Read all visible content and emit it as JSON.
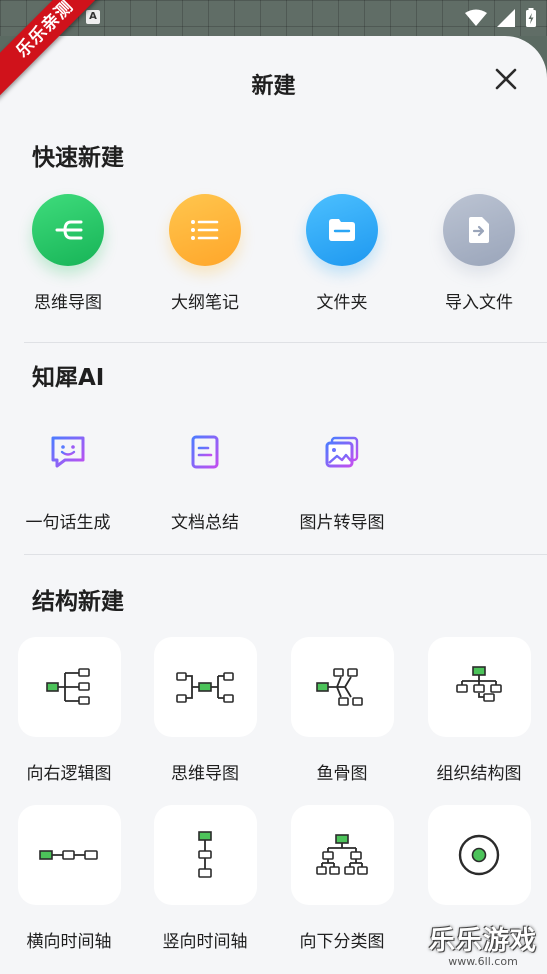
{
  "badge": "乐乐亲测",
  "header": {
    "title": "新建"
  },
  "quick": {
    "title": "快速新建",
    "items": [
      {
        "label": "思维导图",
        "icon": "mindmap-icon",
        "color": "#22c35e"
      },
      {
        "label": "大纲笔记",
        "icon": "outline-list-icon",
        "color": "#ffb627"
      },
      {
        "label": "文件夹",
        "icon": "folder-icon",
        "color": "#2aa6f5"
      },
      {
        "label": "导入文件",
        "icon": "import-file-icon",
        "color": "#a9b3c5"
      }
    ]
  },
  "ai": {
    "title": "知犀AI",
    "items": [
      {
        "label": "一句话生成",
        "icon": "chat-smile-icon"
      },
      {
        "label": "文档总结",
        "icon": "document-icon"
      },
      {
        "label": "图片转导图",
        "icon": "image-icon"
      }
    ]
  },
  "structure": {
    "title": "结构新建",
    "items": [
      {
        "label": "向右逻辑图",
        "icon": "right-logic-icon"
      },
      {
        "label": "思维导图",
        "icon": "mindmap-structure-icon"
      },
      {
        "label": "鱼骨图",
        "icon": "fishbone-icon"
      },
      {
        "label": "组织结构图",
        "icon": "org-chart-icon"
      },
      {
        "label": "横向时间轴",
        "icon": "horizontal-timeline-icon"
      },
      {
        "label": "竖向时间轴",
        "icon": "vertical-timeline-icon"
      },
      {
        "label": "向下分类图",
        "icon": "down-classification-icon"
      },
      {
        "label": "",
        "icon": "circle-target-icon"
      }
    ]
  },
  "watermark": {
    "text": "乐乐游戏",
    "url": "www.6ll.com"
  },
  "colors": {
    "accent_green": "#4cc35a",
    "ai_gradient_start": "#4f7bff",
    "ai_gradient_end": "#c24ff0"
  }
}
